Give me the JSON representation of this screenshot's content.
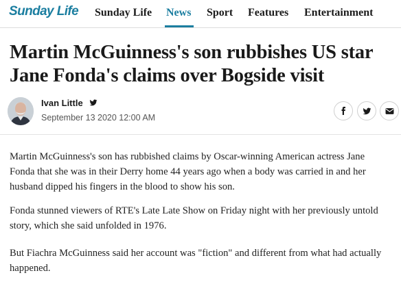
{
  "nav": {
    "logo": "Sunday Life",
    "items": [
      {
        "label": "Sunday Life"
      },
      {
        "label": "News"
      },
      {
        "label": "Sport"
      },
      {
        "label": "Features"
      },
      {
        "label": "Entertainment"
      }
    ],
    "active_index": 1
  },
  "article": {
    "headline": "Martin McGuinness's son rubbishes US star Jane Fonda's claims over Bogside visit",
    "author": "Ivan Little",
    "date": "September 13 2020 12:00 AM",
    "share_icons": [
      "facebook-icon",
      "twitter-icon",
      "email-icon"
    ],
    "paragraphs": [
      "Martin McGuinness's son has rubbished claims by Oscar-winning American actress Jane Fonda that she was in their Derry home 44 years ago when a body was carried in and her husband dipped his fingers in the blood to show his son.",
      "Fonda stunned viewers of RTE's Late Late Show on Friday night with her previously untold story, which she said unfolded in 1976.",
      "But Fiachra McGuinness said her account was \"fiction\" and different from what had actually happened."
    ]
  },
  "colors": {
    "brand": "#1b7ea0",
    "text": "#1a1a1a",
    "muted": "#555555"
  }
}
